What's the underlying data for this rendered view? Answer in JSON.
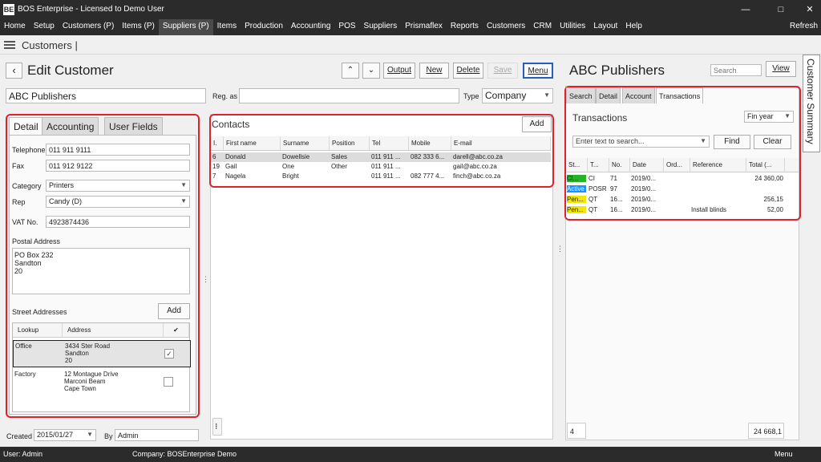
{
  "app": {
    "title": "BOS Enterprise - Licensed to Demo User",
    "logo": "BE"
  },
  "menu": [
    "Home",
    "Setup",
    "Customers (P)",
    "Items (P)",
    "Suppliers (P)",
    "Items",
    "Production",
    "Accounting",
    "POS",
    "Suppliers",
    "Prismaflex",
    "Reports",
    "Customers",
    "CRM",
    "Utilities",
    "Layout",
    "Help"
  ],
  "menu_refresh": "Refresh",
  "nav": {
    "breadcrumb": "Customers |"
  },
  "header": {
    "title": "Edit Customer",
    "output": "Output",
    "new": "New",
    "delete": "Delete",
    "save": "Save",
    "menu": "Menu"
  },
  "customer": {
    "name": "ABC Publishers",
    "reg_label": "Reg. as",
    "reg_value": "",
    "type_label": "Type",
    "type_value": "Company"
  },
  "left_tabs": [
    "Detail",
    "Accounting",
    "User Fields"
  ],
  "detail": {
    "telephone_label": "Telephone",
    "telephone": "011 911 9111",
    "fax_label": "Fax",
    "fax": "011 912 9122",
    "category_label": "Category",
    "category": "Printers",
    "rep_label": "Rep",
    "rep": "Candy (D)",
    "vat_label": "VAT No.",
    "vat": "4923874436",
    "postal_label": "Postal Address",
    "postal": [
      "PO Box 232",
      "Sandton",
      "20"
    ],
    "street_label": "Street Addresses",
    "add": "Add",
    "street_headers": [
      "Lookup",
      "Address",
      "✔"
    ],
    "street_rows": [
      {
        "lookup": "Office",
        "lines": [
          "3434 Ster Road",
          "Sandton",
          "20"
        ],
        "checked": "✓"
      },
      {
        "lookup": "Factory",
        "lines": [
          "12 Montague Drive",
          "Marconi Beam",
          "Cape Town"
        ],
        "checked": ""
      }
    ],
    "created_label": "Created",
    "created": "2015/01/27",
    "by_label": "By",
    "by": "Admin"
  },
  "contacts": {
    "title": "Contacts",
    "add": "Add",
    "headers": [
      "I.",
      "First name",
      "Surname",
      "Position",
      "Tel",
      "Mobile",
      "E-mail"
    ],
    "rows": [
      [
        "6",
        "Donald",
        "Dowellsie",
        "Sales",
        "011 911 ...",
        "082 333 6...",
        "darell@abc.co.za"
      ],
      [
        "19",
        "Gail",
        "One",
        "Other",
        "011 911 ...",
        "",
        "gail@abc.co.za"
      ],
      [
        "7",
        "Nagela",
        "Bright",
        "",
        "011 911 ...",
        "082 777 4...",
        "finch@abc.co.za"
      ]
    ],
    "footer": "⠇"
  },
  "right": {
    "title": "ABC Publishers",
    "search_placeholder": "Search",
    "view": "View",
    "tabs": [
      "Search",
      "Detail",
      "Account",
      "Transactions"
    ],
    "trans_title": "Transactions",
    "period": "Fin year",
    "search_text_placeholder": "Enter text to search...",
    "find": "Find",
    "clear": "Clear",
    "headers": [
      "St...",
      "T...",
      "No.",
      "Date",
      "Ord...",
      "Reference",
      "Total (..."
    ],
    "rows": [
      {
        "status": "Cl...",
        "color": "#27b327",
        "type": "CI",
        "no": "71",
        "date": "2019/0...",
        "ord": "",
        "ref": "",
        "total": "24 360,00"
      },
      {
        "status": "Active",
        "color": "#1e90ff",
        "type": "POSR",
        "no": "97",
        "date": "2019/0...",
        "ord": "",
        "ref": "",
        "total": ""
      },
      {
        "status": "Pen...",
        "color": "#f2e600",
        "type": "QT",
        "no": "16...",
        "date": "2019/0...",
        "ord": "",
        "ref": "",
        "total": "256,15"
      },
      {
        "status": "Pen...",
        "color": "#f2e600",
        "type": "QT",
        "no": "16...",
        "date": "2019/0...",
        "ord": "",
        "ref": "Install blinds",
        "total": "52,00"
      }
    ],
    "count": "4",
    "sum": "24 668,1"
  },
  "side_tab": "Customer Summary",
  "status": {
    "user": "User: Admin",
    "company": "Company: BOSEnterprise Demo",
    "menu": "Menu"
  },
  "colors": {
    "highlight": "#e0202a",
    "dark": "#2b2b2b",
    "menu_border": "#2a5db8"
  }
}
